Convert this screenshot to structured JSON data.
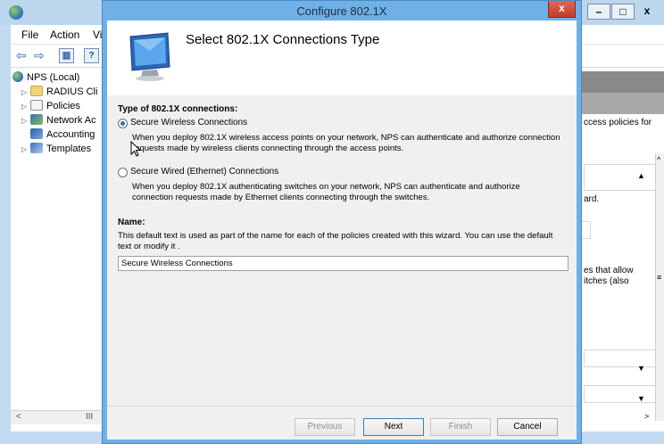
{
  "background_window": {
    "menu": [
      "File",
      "Action",
      "Vi"
    ],
    "window_controls": [
      "–",
      "□",
      "x"
    ],
    "tree": [
      {
        "label": "NPS (Local)",
        "expander": ""
      },
      {
        "label": "RADIUS Cli",
        "expander": "▷"
      },
      {
        "label": "Policies",
        "expander": "▷"
      },
      {
        "label": "Network Ac",
        "expander": "▷"
      },
      {
        "label": "Accounting",
        "expander": ""
      },
      {
        "label": "Templates",
        "expander": "▷"
      }
    ],
    "hscroll": {
      "left": "<",
      "thumb": "III"
    },
    "right_pane": {
      "text1": "ccess policies for",
      "text2": "ard.",
      "text3": "es that allow",
      "text4": "itches (also",
      "scroll_marks": [
        "▲",
        "▼",
        "▼",
        ">",
        "^",
        "≡"
      ]
    }
  },
  "dialog": {
    "title": "Configure 802.1X",
    "close_label": "x",
    "heading": "Select 802.1X Connections Type",
    "type_label": "Type of 802.1X connections:",
    "options": [
      {
        "label": "Secure Wireless Connections",
        "selected": true,
        "description": "When you deploy 802.1X wireless access points on your network, NPS can authenticate and authorize connection requests made by wireless clients connecting through the access points."
      },
      {
        "label": "Secure Wired (Ethernet) Connections",
        "selected": false,
        "description": "When you deploy 802.1X authenticating switches on your network, NPS can authenticate and authorize connection requests made by Ethernet clients connecting through the switches."
      }
    ],
    "name_label": "Name:",
    "name_help": "This default text is used as part of the name for each of the policies created with this wizard. You can use the default text or modify it .",
    "name_value": "Secure Wireless Connections",
    "buttons": {
      "previous": "Previous",
      "next": "Next",
      "finish": "Finish",
      "cancel": "Cancel"
    }
  },
  "colors": {
    "accent_frame": "#6fb0e6",
    "close_button": "#c33d29",
    "radio_selected": "#2a6fc9"
  }
}
